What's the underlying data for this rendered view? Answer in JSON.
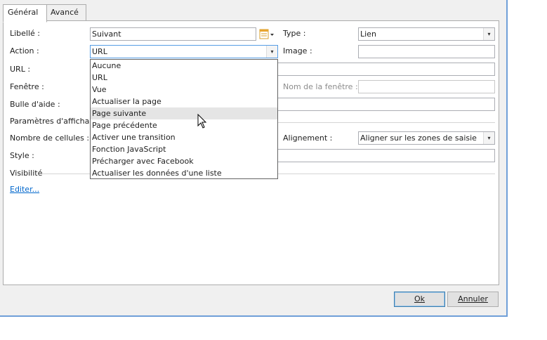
{
  "tabs": [
    {
      "label": "Général",
      "active": true
    },
    {
      "label": "Avancé",
      "active": false
    }
  ],
  "form": {
    "libelle": {
      "label": "Libellé :",
      "value": "Suivant"
    },
    "type": {
      "label": "Type :",
      "value": "Lien"
    },
    "action": {
      "label": "Action :",
      "value": "URL"
    },
    "image": {
      "label": "Image :",
      "value": ""
    },
    "url": {
      "label": "URL :",
      "value": ""
    },
    "fenetre": {
      "label": "Fenêtre :"
    },
    "nom_fenetre": {
      "label": "Nom de la fenêtre :",
      "value": ""
    },
    "bulle": {
      "label": "Bulle d'aide :",
      "value": ""
    },
    "parametres": {
      "label": "Paramètres d'affichag"
    },
    "nb_cellules": {
      "label": "Nombre de cellules :"
    },
    "alignement": {
      "label": "Alignement :",
      "value": "Aligner sur les zones de saisie"
    },
    "style": {
      "label": "Style :",
      "value": ""
    },
    "visibilite": {
      "label": "Visibilité"
    },
    "editer_link": "Editer..."
  },
  "action_options": [
    "Aucune",
    "URL",
    "Vue",
    "Actualiser la page",
    "Page suivante",
    "Page précédente",
    "Activer une transition",
    "Fonction JavaScript",
    "Précharger avec Facebook",
    "Actualiser les données d'une liste"
  ],
  "hovered_option_index": 4,
  "buttons": {
    "ok": "Ok",
    "cancel": "Annuler"
  },
  "icons": {
    "combo_arrow": "▾",
    "cal_icon": "calendar-list-icon",
    "cursor": "arrow-cursor-icon"
  },
  "colors": {
    "window_border": "#6f9fd8",
    "link": "#0066cc",
    "hover": "#e5e5e5"
  }
}
